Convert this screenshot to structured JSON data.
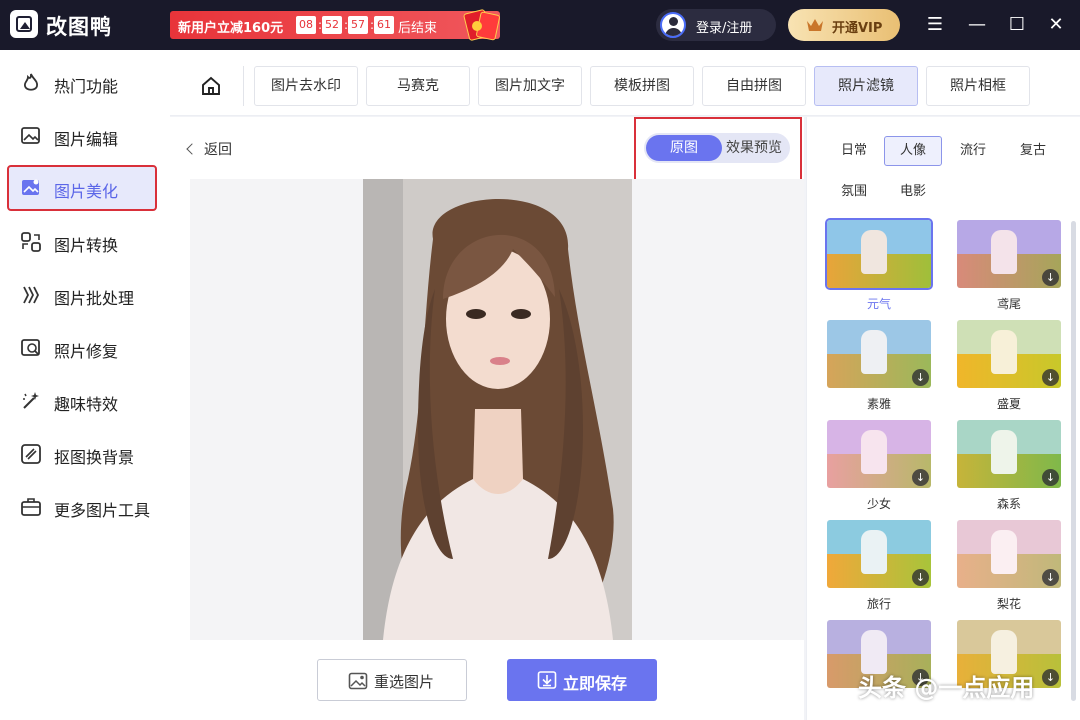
{
  "app": {
    "title": "改图鸭"
  },
  "promo": {
    "text": "新用户立减160元",
    "timer": [
      "08",
      "52",
      "57",
      "61"
    ],
    "end_text": "后结束"
  },
  "header": {
    "login_label": "登录/注册",
    "vip_label": "开通VIP",
    "controls": {
      "menu": "☰",
      "minimize": "—",
      "maximize": "☐",
      "close": "✕"
    }
  },
  "sidebar": {
    "items": [
      {
        "label": "热门功能",
        "icon": "flame-icon"
      },
      {
        "label": "图片编辑",
        "icon": "image-edit-icon"
      },
      {
        "label": "图片美化",
        "icon": "image-beautify-icon",
        "active": true
      },
      {
        "label": "图片转换",
        "icon": "convert-icon"
      },
      {
        "label": "图片批处理",
        "icon": "batch-icon"
      },
      {
        "label": "照片修复",
        "icon": "photo-repair-icon"
      },
      {
        "label": "趣味特效",
        "icon": "magic-wand-icon"
      },
      {
        "label": "抠图换背景",
        "icon": "cutout-icon"
      },
      {
        "label": "更多图片工具",
        "icon": "toolbox-icon"
      }
    ]
  },
  "tabs": [
    {
      "label": "图片去水印"
    },
    {
      "label": "马赛克"
    },
    {
      "label": "图片加文字"
    },
    {
      "label": "模板拼图"
    },
    {
      "label": "自由拼图"
    },
    {
      "label": "照片滤镜",
      "active": true
    },
    {
      "label": "照片相框"
    }
  ],
  "main": {
    "back_label": "返回",
    "toggle": {
      "original": "原图",
      "preview": "效果预览"
    },
    "reselect_label": "重选图片",
    "save_label": "立即保存"
  },
  "filters": {
    "categories": [
      {
        "label": "日常"
      },
      {
        "label": "人像",
        "active": true
      },
      {
        "label": "流行"
      },
      {
        "label": "复古"
      },
      {
        "label": "氛围"
      },
      {
        "label": "电影"
      }
    ],
    "items": [
      {
        "label": "元气",
        "selected": true
      },
      {
        "label": "鸢尾"
      },
      {
        "label": "素雅"
      },
      {
        "label": "盛夏"
      },
      {
        "label": "少女"
      },
      {
        "label": "森系"
      },
      {
        "label": "旅行"
      },
      {
        "label": "梨花"
      },
      {
        "label": ""
      },
      {
        "label": ""
      }
    ]
  },
  "watermark": "头条 @一点应用",
  "colors": {
    "accent": "#6a74ef",
    "highlight_box": "#d9303a",
    "titlebar": "#19192a"
  }
}
